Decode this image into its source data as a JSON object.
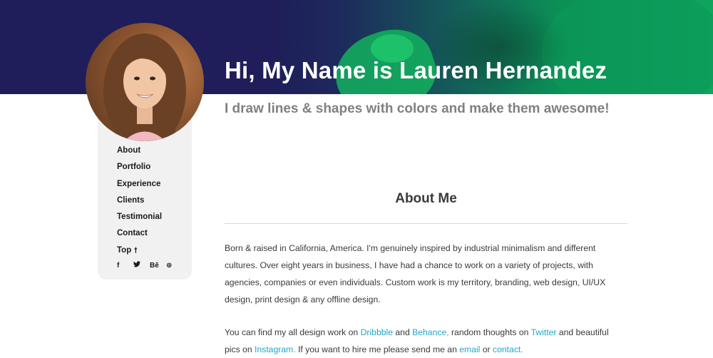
{
  "header": {
    "title": "Hi, My Name is Lauren Hernandez",
    "tagline": "I draw lines & shapes with colors and make them awesome!"
  },
  "sidebar": {
    "nav": [
      "About",
      "Portfolio",
      "Experience",
      "Clients",
      "Testimonial",
      "Contact",
      "Top"
    ],
    "social": [
      {
        "icon": "facebook-icon",
        "glyph": "f"
      },
      {
        "icon": "twitter-icon",
        "glyph": "🐦"
      },
      {
        "icon": "behance-icon",
        "glyph": "Bē"
      },
      {
        "icon": "dribbble-icon",
        "glyph": "⊛"
      }
    ]
  },
  "about": {
    "heading": "About Me",
    "bio": "Born & raised in California, America. I'm genuinely inspired by industrial minimalism and different cultures. Over eight years in business, I have had a chance to work on a variety of projects, with agencies, companies or even individuals. Custom work is my territory, branding, web design, UI/UX design, print design & any offline design.",
    "links": {
      "t1": "You can find my all design work on ",
      "dribbble": "Dribbble",
      "t2": " and ",
      "behance": "Behance,",
      "t3": " random thoughts on ",
      "twitter": "Twitter",
      "t4": " and beautiful pics on ",
      "instagram": "Instagram.",
      "t5": " If you want to hire me please send me an ",
      "email": "email",
      "t6": " or ",
      "contact": "contact."
    }
  },
  "colors": {
    "link": "#21a7c5",
    "hero_dark": "#1f1d5a",
    "hero_green": "#0ea55e",
    "sidebar_bg": "#f1f1f1"
  }
}
